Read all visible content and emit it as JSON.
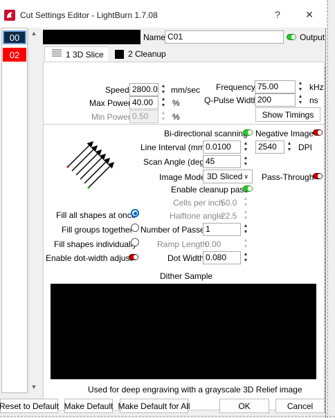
{
  "window": {
    "title": "Cut Settings Editor - LightBurn 1.7.08",
    "help_glyph": "?",
    "close_glyph": "✕"
  },
  "layers": [
    {
      "label": "00",
      "color": "#0c2a4a"
    },
    {
      "label": "02",
      "color": "#ff0000"
    }
  ],
  "header": {
    "name_label": "Name",
    "name_value": "C01",
    "output_label": "Output",
    "output_on": true
  },
  "tabs": [
    {
      "label": "1 3D Slice",
      "active": true,
      "icon": "slice-icon"
    },
    {
      "label": "2 Cleanup",
      "active": false,
      "icon": "black-swatch-icon"
    }
  ],
  "power": {
    "speed_label": "Speed",
    "speed_value": "2800.0",
    "speed_unit": "mm/sec",
    "max_power_label": "Max Power",
    "max_power_value": "40.00",
    "max_power_unit": "%",
    "min_power_label": "Min Power",
    "min_power_value": "0.50",
    "min_power_unit": "%"
  },
  "pulse": {
    "frequency_label": "Frequency",
    "frequency_value": "75.00",
    "frequency_unit": "kHz",
    "qpulse_label": "Q-Pulse Width",
    "qpulse_value": "200",
    "qpulse_unit": "ns",
    "timings_button": "Show Timings"
  },
  "scan": {
    "bidir_label": "Bi-directional scanning",
    "bidir_on": true,
    "negative_label": "Negative Image",
    "negative_on": false,
    "line_interval_label": "Line Interval (mm)",
    "line_interval_value": "0.0100",
    "dpi_value": "2540",
    "dpi_label": "DPI",
    "scan_angle_label": "Scan Angle (deg)",
    "scan_angle_value": "45",
    "image_mode_label": "Image Mode",
    "image_mode_value": "3D Sliced",
    "pass_through_label": "Pass-Through",
    "pass_through_on": false,
    "cleanup_label": "Enable cleanup pass",
    "cleanup_on": true,
    "cells_label": "Cells per inch",
    "cells_value": "50.0",
    "halftone_label": "Halftone angle",
    "halftone_value": "22.5"
  },
  "fill": {
    "fill_all_label": "Fill all shapes at once",
    "fill_groups_label": "Fill groups together",
    "fill_individually_label": "Fill shapes individually",
    "dot_width_adjust_label": "Enable dot-width adjust",
    "dot_width_adjust_on": false,
    "selected": "fill_all"
  },
  "passes": {
    "number_label": "Number of Passes",
    "number_value": "1",
    "ramp_label": "Ramp Length",
    "ramp_value": "0.00",
    "dot_width_label": "Dot Width",
    "dot_width_value": "0.080"
  },
  "dither": {
    "title": "Dither Sample",
    "description": "Used for deep engraving with a grayscale 3D Relief image"
  },
  "footer": {
    "reset": "Reset to Default",
    "make_default": "Make Default",
    "make_default_all": "Make Default for All",
    "ok": "OK",
    "cancel": "Cancel"
  }
}
